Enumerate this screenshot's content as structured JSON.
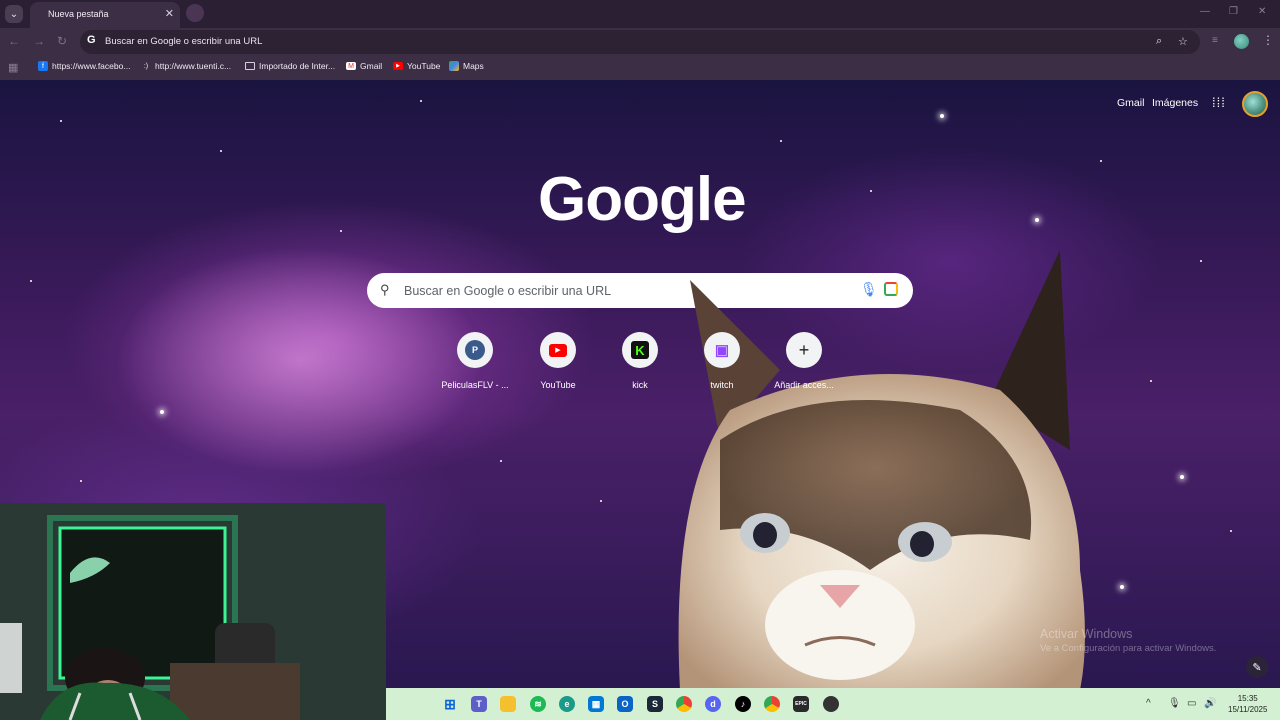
{
  "browser": {
    "tab": {
      "title": "Nueva pestaña"
    },
    "omnibox": {
      "text": "Buscar en Google o escribir una URL"
    }
  },
  "bookmarks": [
    {
      "label": "https://www.facebo...",
      "icon": "facebook-icon"
    },
    {
      "label": "http://www.tuenti.c...",
      "icon": "tuenti-icon"
    },
    {
      "label": "Importado de Inter...",
      "icon": "folder-icon"
    },
    {
      "label": "Gmail",
      "icon": "gmail-icon"
    },
    {
      "label": "YouTube",
      "icon": "youtube-icon"
    },
    {
      "label": "Maps",
      "icon": "maps-icon"
    }
  ],
  "ntp": {
    "top_links": {
      "gmail": "Gmail",
      "images": "Imágenes"
    },
    "logo": "Google",
    "search_placeholder": "Buscar en Google o escribir una URL",
    "shortcuts": [
      {
        "label": "PeliculasFLV - ...",
        "glyph": "P",
        "color": "#3b5a8c"
      },
      {
        "label": "YouTube",
        "glyph": "▶",
        "color": "#ff0000"
      },
      {
        "label": "kick",
        "glyph": "K",
        "color": "#111111"
      },
      {
        "label": "twitch",
        "glyph": "▣",
        "color": "#9146ff"
      },
      {
        "label": "Añadir acces...",
        "glyph": "+",
        "color": "#202124"
      }
    ]
  },
  "watermark": {
    "title": "Activar Windows",
    "subtitle": "Ve a Configuración para activar Windows."
  },
  "taskbar": {
    "time": "15:35",
    "date": "15/11/2025"
  }
}
